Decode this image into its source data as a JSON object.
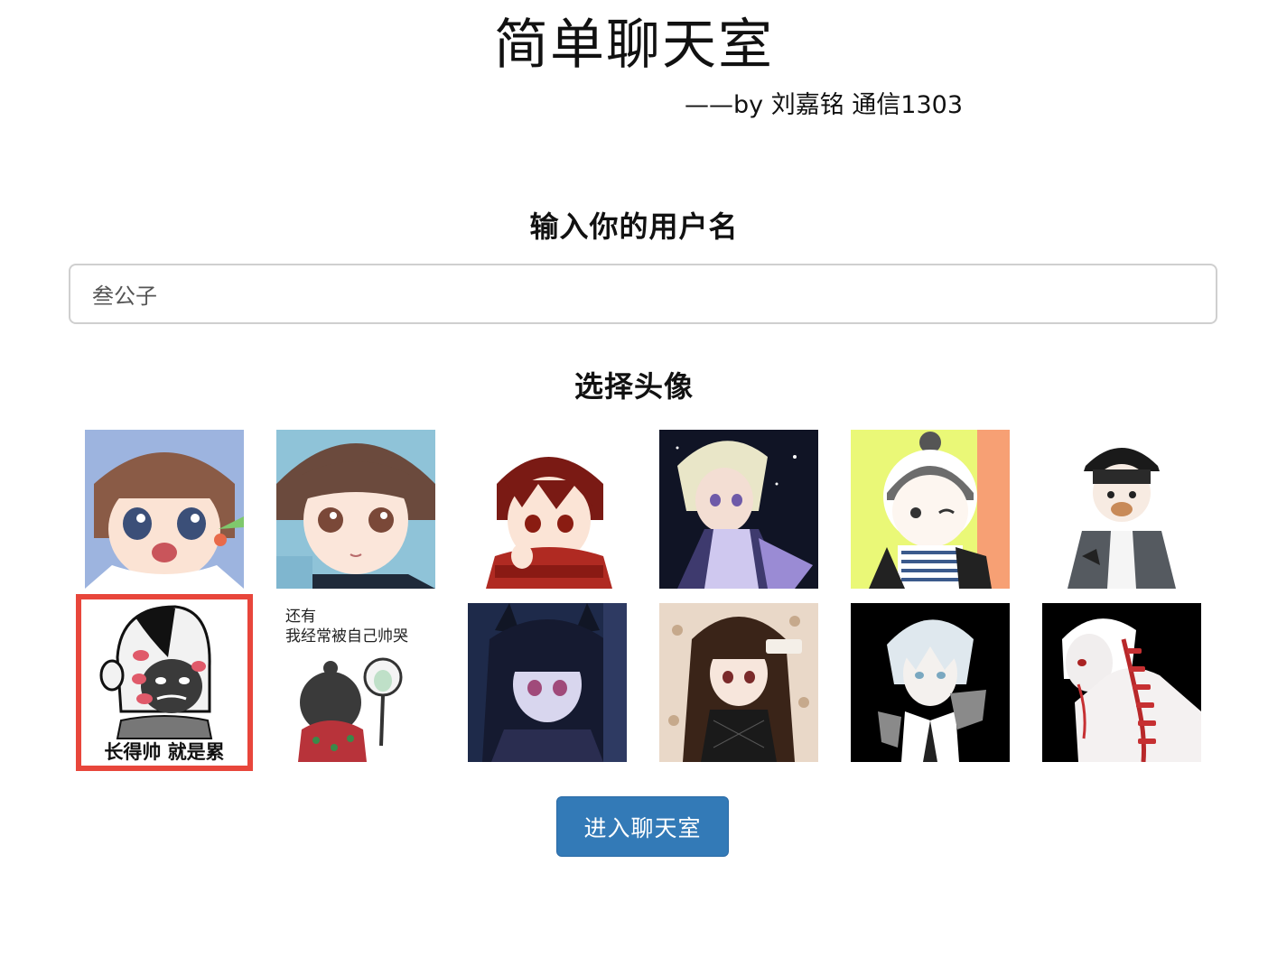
{
  "header": {
    "title": "简单聊天室",
    "byline": "——by 刘嘉铭 通信1303"
  },
  "username_section": {
    "heading": "输入你的用户名",
    "input_value": "叁公子"
  },
  "avatar_section": {
    "heading": "选择头像",
    "selected_index": 6,
    "meme_caption_1": "长得帅 就是累",
    "meme_caption_2_line1": "还有",
    "meme_caption_2_line2": "我经常被自己帅哭"
  },
  "actions": {
    "enter_label": "进入聊天室"
  },
  "colors": {
    "selected_outline": "#e8463b",
    "button_bg": "#337ab7"
  }
}
